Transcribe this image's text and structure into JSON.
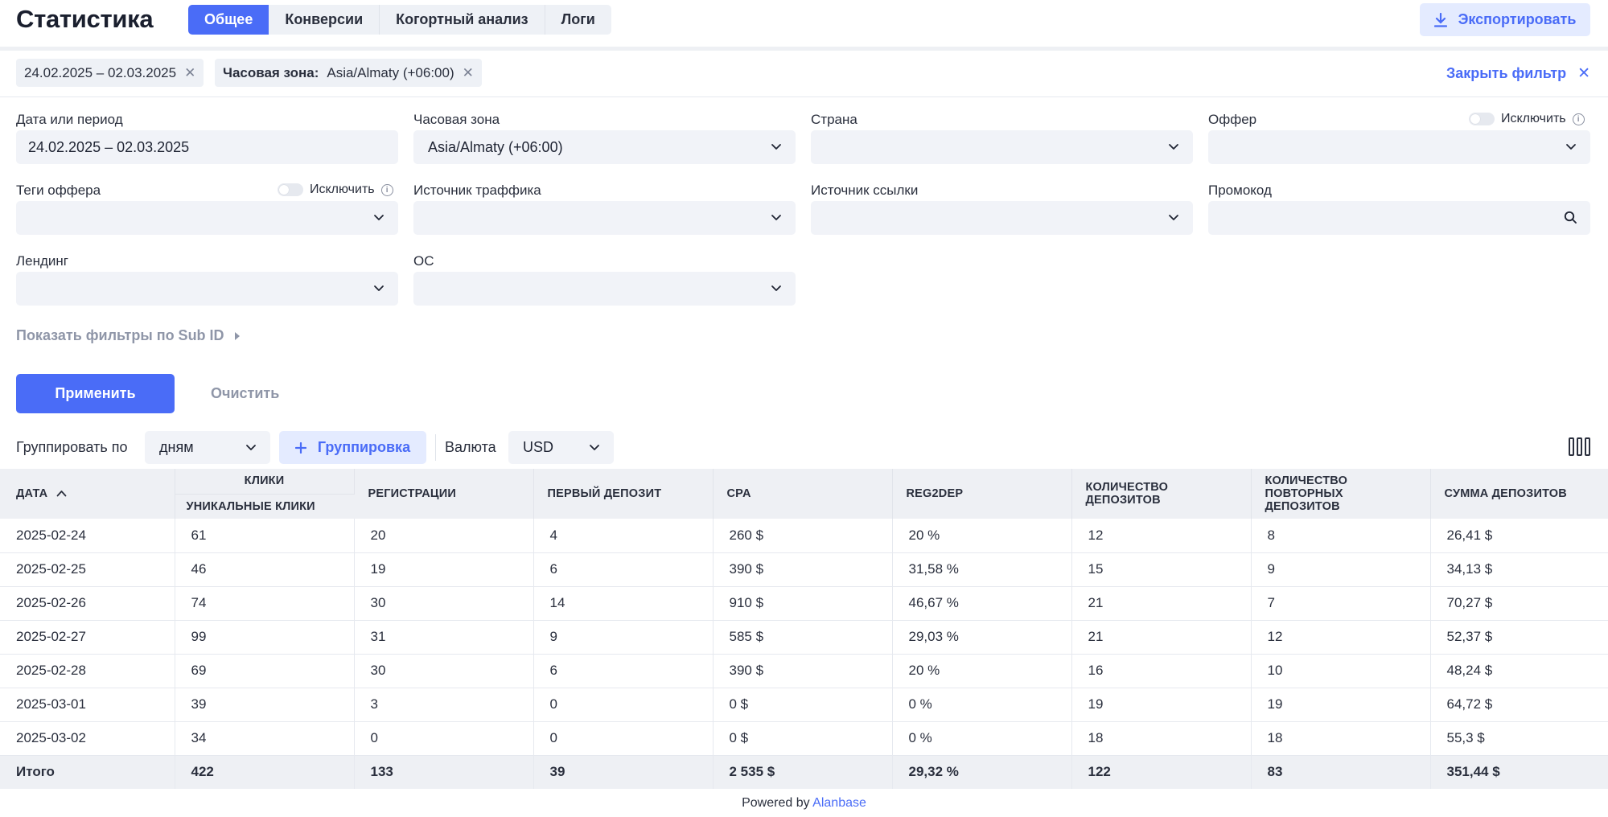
{
  "header": {
    "title": "Статистика",
    "tabs": [
      "Общее",
      "Конверсии",
      "Когортный анализ",
      "Логи"
    ],
    "export_label": "Экспортировать"
  },
  "chips": {
    "period": "24.02.2025 – 02.03.2025",
    "tz_label": "Часовая зона:",
    "tz_value": "Asia/Almaty (+06:00)",
    "close_filter": "Закрыть фильтр"
  },
  "filters": {
    "date_label": "Дата или период",
    "date_value": "24.02.2025 – 02.03.2025",
    "tz_label": "Часовая зона",
    "tz_value": "Asia/Almaty (+06:00)",
    "country_label": "Страна",
    "offer_label": "Оффер",
    "exclude_label": "Исключить",
    "offer_tags_label": "Теги оффера",
    "traffic_source_label": "Источник траффика",
    "link_source_label": "Источник ссылки",
    "promo_label": "Промокод",
    "landing_label": "Лендинг",
    "os_label": "ОС",
    "subid_link": "Показать фильтры по Sub ID",
    "apply": "Применить",
    "clear": "Очистить"
  },
  "grouping": {
    "group_by_label": "Группировать по",
    "group_by_value": "дням",
    "group_button": "Группировка",
    "currency_label": "Валюта",
    "currency_value": "USD"
  },
  "table": {
    "headers": {
      "date": "ДАТА",
      "clicks": "КЛИКИ",
      "unique_clicks": "УНИКАЛЬНЫЕ КЛИКИ",
      "registrations": "РЕГИСТРАЦИИ",
      "first_deposit": "ПЕРВЫЙ ДЕПОЗИТ",
      "cpa": "CPA",
      "reg2dep": "REG2DEP",
      "deposits_count": "КОЛИЧЕСТВО ДЕПОЗИТОВ",
      "repeat_deposits": "КОЛИЧЕСТВО ПОВТОРНЫХ ДЕПОЗИТОВ",
      "deposits_sum": "СУММА ДЕПОЗИТОВ"
    },
    "rows": [
      [
        "2025-02-24",
        "61",
        "20",
        "4",
        "260 $",
        "20 %",
        "12",
        "8",
        "26,41 $"
      ],
      [
        "2025-02-25",
        "46",
        "19",
        "6",
        "390 $",
        "31,58 %",
        "15",
        "9",
        "34,13 $"
      ],
      [
        "2025-02-26",
        "74",
        "30",
        "14",
        "910 $",
        "46,67 %",
        "21",
        "7",
        "70,27 $"
      ],
      [
        "2025-02-27",
        "99",
        "31",
        "9",
        "585 $",
        "29,03 %",
        "21",
        "12",
        "52,37 $"
      ],
      [
        "2025-02-28",
        "69",
        "30",
        "6",
        "390 $",
        "20 %",
        "16",
        "10",
        "48,24 $"
      ],
      [
        "2025-03-01",
        "39",
        "3",
        "0",
        "0 $",
        "0 %",
        "19",
        "19",
        "64,72 $"
      ],
      [
        "2025-03-02",
        "34",
        "0",
        "0",
        "0 $",
        "0 %",
        "18",
        "18",
        "55,3 $"
      ]
    ],
    "total": [
      "Итого",
      "422",
      "133",
      "39",
      "2 535 $",
      "29,32 %",
      "122",
      "83",
      "351,44 $"
    ]
  },
  "footer": {
    "powered_by": "Powered by",
    "brand": "Alanbase"
  },
  "colors": {
    "accent": "#4a6cf7",
    "field_bg": "#f1f3f8",
    "header_bg": "#eef0f4"
  }
}
